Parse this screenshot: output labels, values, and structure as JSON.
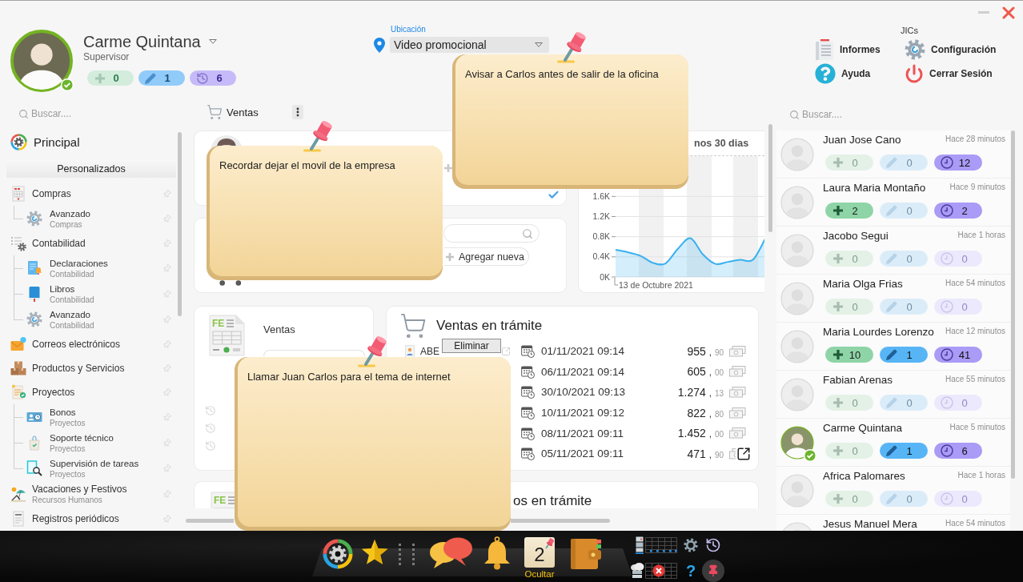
{
  "profile": {
    "name": "Carme Quintana",
    "role": "Supervisor",
    "online": true,
    "badges": [
      {
        "kind": "added",
        "count": "0",
        "active": false
      },
      {
        "kind": "edited",
        "count": "1",
        "active": true
      },
      {
        "kind": "history",
        "count": "6",
        "active": true
      }
    ]
  },
  "location": {
    "label": "Ubicación",
    "value": "Video promocional"
  },
  "header_actions": {
    "group_label": "JICs",
    "items": [
      {
        "kind": "reports",
        "label": "Informes"
      },
      {
        "kind": "settings",
        "label": "Configuración"
      },
      {
        "kind": "help",
        "label": "Ayuda"
      },
      {
        "kind": "logout",
        "label": "Cerrar Sesión"
      }
    ]
  },
  "sidebar": {
    "search": {
      "placeholder": "Buscar...."
    },
    "home": {
      "label": "Principal"
    },
    "section_title": "Personalizados",
    "items": [
      {
        "label": "Compras",
        "children": [
          {
            "label": "Avanzado",
            "sublabel": "Compras"
          }
        ]
      },
      {
        "label": "Contabilidad",
        "children": [
          {
            "label": "Declaraciones",
            "sublabel": "Contabilidad"
          },
          {
            "label": "Libros",
            "sublabel": "Contabilidad"
          },
          {
            "label": "Avanzado",
            "sublabel": "Contabilidad"
          }
        ]
      },
      {
        "label": "Correos electrónicos"
      },
      {
        "label": "Productos y Servicios"
      },
      {
        "label": "Proyectos",
        "children": [
          {
            "label": "Bonos",
            "sublabel": "Proyectos"
          },
          {
            "label": "Soporte técnico",
            "sublabel": "Proyectos"
          },
          {
            "label": "Supervisión de tareas",
            "sublabel": "Proyectos"
          }
        ]
      },
      {
        "label": "Vacaciones y Festivos",
        "sublabel": "Recursos Humanos"
      },
      {
        "label": "Registros periódicos"
      }
    ]
  },
  "workspace": {
    "toolbar": {
      "title": "Ventas"
    },
    "quick_actions": {
      "add_label": "Agregar nueva"
    },
    "chart_card": {
      "chart_data": {
        "type": "area",
        "title": "nos 30 dias",
        "xlabel": "13 de Octubre 2021",
        "ylim": [
          0,
          2400
        ],
        "yticks": [
          {
            "value": 0,
            "label": "0K"
          },
          {
            "value": 400,
            "label": "0.4K"
          },
          {
            "value": 800,
            "label": "0.8K"
          },
          {
            "value": 1200,
            "label": "1.2K"
          },
          {
            "value": 1600,
            "label": "1.6K"
          }
        ],
        "grid": true,
        "series": [
          {
            "color": "#3ab0f0",
            "values": [
              540,
              490,
              420,
              280,
              270,
              560,
              770,
              450,
              260,
              300,
              340,
              340,
              760
            ]
          }
        ]
      }
    },
    "sales_card": {
      "icon_label": "FE",
      "title": "Ventas"
    },
    "pending_sales": {
      "title": "Ventas en trámite",
      "tooltip": "Eliminar",
      "rows": [
        {
          "client": "ABE",
          "date": "01/11/2021 09:14",
          "amount": "955",
          "separator": ",",
          "cents": "90"
        },
        {
          "date": "06/11/2021 09:14",
          "amount": "605",
          "separator": ",",
          "cents": "00"
        },
        {
          "date": "30/10/2021 09:13",
          "amount": "1.274",
          "separator": ",",
          "cents": "13"
        },
        {
          "date": "10/11/2021 09:12",
          "amount": "822",
          "separator": ",",
          "cents": "80"
        },
        {
          "date": "08/11/2021 09:11",
          "amount": "1.452",
          "separator": ",",
          "cents": "00"
        },
        {
          "date": "05/11/2021 09:11",
          "amount": "471",
          "separator": ",",
          "cents": "90"
        }
      ]
    },
    "orders_card": {
      "icon_label": "FE",
      "title": "os en trámite"
    }
  },
  "users": {
    "search": {
      "placeholder": "Buscar...."
    },
    "items": [
      {
        "name": "Juan Jose Cano",
        "last_seen": "Hace 28 minutos",
        "online": false,
        "badges": [
          {
            "kind": "added",
            "count": "0",
            "active": false
          },
          {
            "kind": "edited",
            "count": "0",
            "active": false
          },
          {
            "kind": "history",
            "count": "12",
            "active": true
          }
        ]
      },
      {
        "name": "Laura Maria Montaño",
        "last_seen": "Hace 9 minutos",
        "online": false,
        "badges": [
          {
            "kind": "added",
            "count": "2",
            "active": true
          },
          {
            "kind": "edited",
            "count": "0",
            "active": false
          },
          {
            "kind": "history",
            "count": "2",
            "active": true
          }
        ]
      },
      {
        "name": "Jacobo Segui",
        "last_seen": "Hace 1 horas",
        "online": false,
        "badges": [
          {
            "kind": "added",
            "count": "0",
            "active": false
          },
          {
            "kind": "edited",
            "count": "0",
            "active": false
          },
          {
            "kind": "history",
            "count": "0",
            "active": false
          }
        ]
      },
      {
        "name": "Maria Olga Frias",
        "last_seen": "Hace 54 minutos",
        "online": false,
        "badges": [
          {
            "kind": "added",
            "count": "0",
            "active": false
          },
          {
            "kind": "edited",
            "count": "0",
            "active": false
          },
          {
            "kind": "history",
            "count": "0",
            "active": false
          }
        ]
      },
      {
        "name": "Maria Lourdes Lorenzo",
        "last_seen": "Hace 12 minutos",
        "online": false,
        "badges": [
          {
            "kind": "added",
            "count": "10",
            "active": true
          },
          {
            "kind": "edited",
            "count": "1",
            "active": true
          },
          {
            "kind": "history",
            "count": "41",
            "active": true
          }
        ]
      },
      {
        "name": "Fabian Arenas",
        "last_seen": "Hace 55 minutos",
        "online": false,
        "badges": [
          {
            "kind": "added",
            "count": "0",
            "active": false
          },
          {
            "kind": "edited",
            "count": "0",
            "active": false
          },
          {
            "kind": "history",
            "count": "0",
            "active": false
          }
        ]
      },
      {
        "name": "Carme Quintana",
        "last_seen": "Hace 5 minutos",
        "online": true,
        "badges": [
          {
            "kind": "added",
            "count": "0",
            "active": false
          },
          {
            "kind": "edited",
            "count": "1",
            "active": true
          },
          {
            "kind": "history",
            "count": "6",
            "active": true
          }
        ]
      },
      {
        "name": "Africa Palomares",
        "last_seen": "Hace 1 horas",
        "online": false,
        "badges": [
          {
            "kind": "added",
            "count": "0",
            "active": false
          },
          {
            "kind": "edited",
            "count": "0",
            "active": false
          },
          {
            "kind": "history",
            "count": "0",
            "active": false
          }
        ]
      },
      {
        "name": "Jesus Manuel Mera",
        "last_seen": "Hace 54 minutos",
        "online": false
      }
    ]
  },
  "sticky_notes": [
    {
      "text": "Avisar a Carlos antes de salir de la oficina"
    },
    {
      "text": "Recordar dejar el movil de la empresa"
    },
    {
      "text": "Llamar Juan Carlos para el tema de internet"
    }
  ],
  "dock": {
    "notes_count": "2",
    "hide_label": "Ocultar",
    "help_label": "?"
  }
}
